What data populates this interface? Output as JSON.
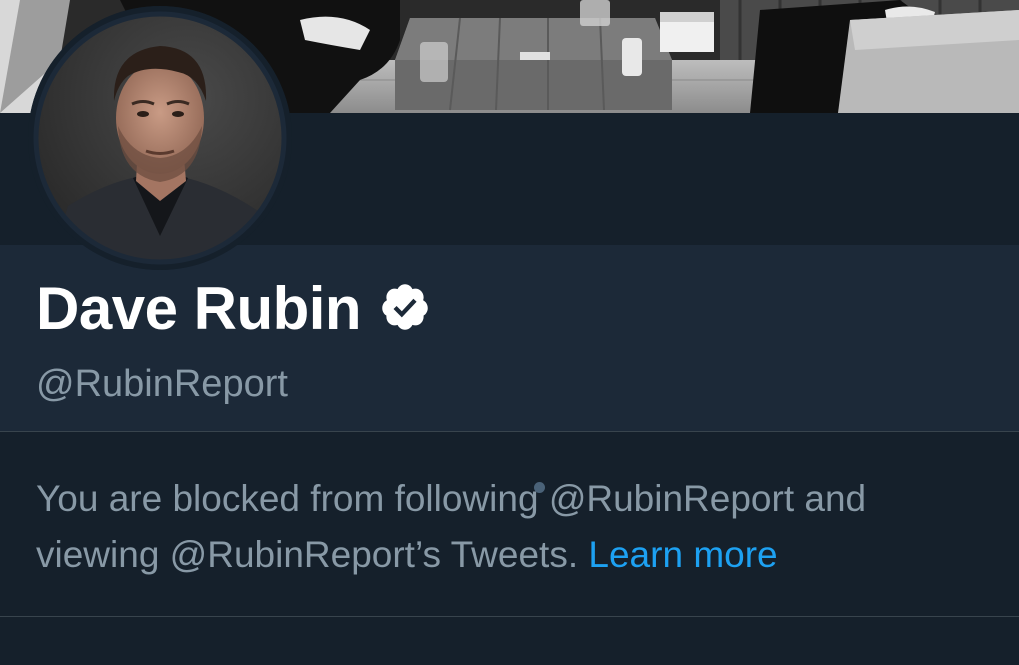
{
  "profile": {
    "display_name": "Dave Rubin",
    "handle": "@RubinReport",
    "verified": true,
    "verified_icon": "verified-badge-icon"
  },
  "notice": {
    "text": "You are blocked from following @RubinReport and viewing @RubinReport’s Tweets.",
    "link_label": "Learn more"
  },
  "colors": {
    "background": "#15202b",
    "header_background": "#1c2938",
    "primary_text": "#ffffff",
    "secondary_text": "#8899a6",
    "link": "#1da1f2",
    "divider": "#38444d"
  }
}
